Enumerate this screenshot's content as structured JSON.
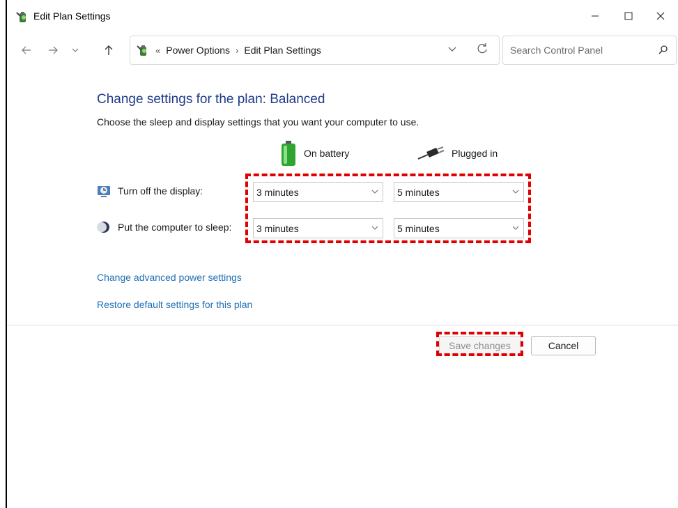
{
  "window": {
    "title": "Edit Plan Settings",
    "minimize_icon": "minimize-icon",
    "maximize_icon": "maximize-icon",
    "close_icon": "close-icon"
  },
  "nav": {
    "breadcrumb_prefix": "«",
    "breadcrumbs": [
      "Power Options",
      "Edit Plan Settings"
    ],
    "search_placeholder": "Search Control Panel"
  },
  "main": {
    "heading": "Change settings for the plan: Balanced",
    "subtext": "Choose the sleep and display settings that you want your computer to use.",
    "columns": {
      "battery": "On battery",
      "plugged": "Plugged in"
    },
    "rows": [
      {
        "label": "Turn off the display:",
        "battery_value": "3 minutes",
        "plugged_value": "5 minutes"
      },
      {
        "label": "Put the computer to sleep:",
        "battery_value": "3 minutes",
        "plugged_value": "5 minutes"
      }
    ],
    "links": {
      "advanced": "Change advanced power settings",
      "restore": "Restore default settings for this plan"
    }
  },
  "footer": {
    "save_label": "Save changes",
    "cancel_label": "Cancel"
  },
  "colors": {
    "heading": "#1e3a8a",
    "link": "#1f6fb5",
    "highlight": "#e00000"
  }
}
